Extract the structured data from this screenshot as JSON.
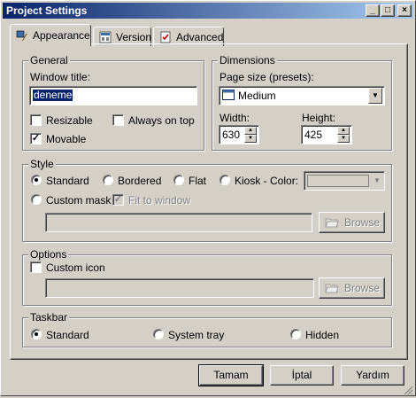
{
  "window": {
    "title": "Project Settings",
    "controls": {
      "minimize": "_",
      "maximize": "□",
      "close": "×"
    }
  },
  "tabs": [
    {
      "label": "Appearance",
      "icon": "appearance-icon",
      "active": true
    },
    {
      "label": "Version",
      "icon": "version-icon",
      "active": false
    },
    {
      "label": "Advanced",
      "icon": "advanced-icon",
      "active": false
    }
  ],
  "general": {
    "group_label": "General",
    "window_title_label": "Window title:",
    "window_title_value": "deneme",
    "resizable_label": "Resizable",
    "always_on_top_label": "Always on top",
    "movable_label": "Movable",
    "check_mark": "✓"
  },
  "dimensions": {
    "group_label": "Dimensions",
    "page_size_label": "Page size (presets):",
    "page_size_value": "Medium",
    "width_label": "Width:",
    "width_value": "630",
    "height_label": "Height:",
    "height_value": "425"
  },
  "style": {
    "group_label": "Style",
    "options": [
      "Standard",
      "Bordered",
      "Flat",
      "Kiosk - Color:",
      "Custom mask"
    ],
    "selected": "Standard",
    "fit_to_window_label": "Fit to window",
    "browse_label": "Browse"
  },
  "options": {
    "group_label": "Options",
    "custom_icon_label": "Custom icon",
    "browse_label": "Browse"
  },
  "taskbar": {
    "group_label": "Taskbar",
    "options": [
      "Standard",
      "System tray",
      "Hidden"
    ],
    "selected": "Standard"
  },
  "footer": {
    "ok_label": "Tamam",
    "cancel_label": "İptal",
    "help_label": "Yardım"
  },
  "colors": {
    "title_gradient_start": "#0a246a",
    "title_gradient_end": "#a6caf0",
    "face": "#d4d0c8",
    "selection": "#0a246a"
  }
}
